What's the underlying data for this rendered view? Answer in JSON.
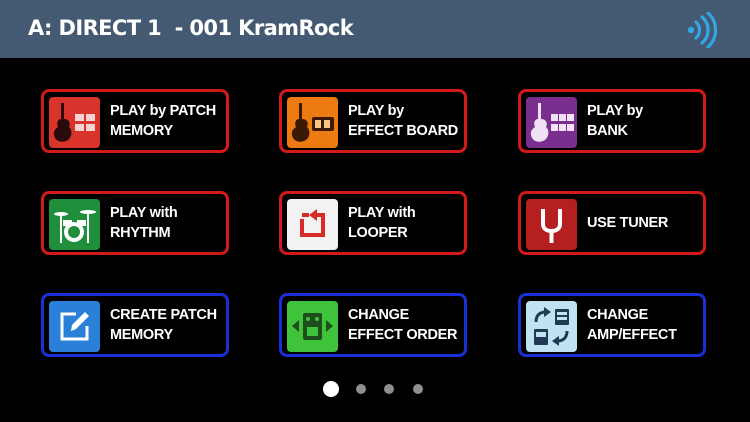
{
  "header": {
    "title": "A: DIRECT 1  - 001 KramRock"
  },
  "buttons": [
    {
      "line1": "PLAY by PATCH",
      "line2": "MEMORY",
      "icon": "patch-memory-icon",
      "icon_color": "#d9342b",
      "border": "#d11b1b"
    },
    {
      "line1": "PLAY by",
      "line2": "EFFECT BOARD",
      "icon": "effect-board-icon",
      "icon_color": "#ee7a12",
      "border": "#d11b1b"
    },
    {
      "line1": "PLAY by",
      "line2": "BANK",
      "icon": "bank-icon",
      "icon_color": "#7a2f8f",
      "border": "#d11b1b"
    },
    {
      "line1": "PLAY with",
      "line2": "RHYTHM",
      "icon": "drum-kit-icon",
      "icon_color": "#1f8f3c",
      "border": "#d11b1b"
    },
    {
      "line1": "PLAY with",
      "line2": "LOOPER",
      "icon": "looper-icon",
      "icon_color": "#f2f2f2",
      "border": "#d11b1b"
    },
    {
      "line1": "USE TUNER",
      "line2": "",
      "icon": "tuning-fork-icon",
      "icon_color": "#b51f1f",
      "border": "#d11b1b"
    },
    {
      "line1": "CREATE PATCH",
      "line2": "MEMORY",
      "icon": "edit-icon",
      "icon_color": "#2a7fd8",
      "border": "#1b2fd6"
    },
    {
      "line1": "CHANGE",
      "line2": "EFFECT ORDER",
      "icon": "effect-order-icon",
      "icon_color": "#3fc33a",
      "border": "#1b2fd6"
    },
    {
      "line1": "CHANGE",
      "line2": "AMP/EFFECT",
      "icon": "swap-amp-effect-icon",
      "icon_color": "#bfe3f1",
      "border": "#1b2fd6"
    }
  ],
  "pagination": {
    "pages": 4,
    "current": 1
  }
}
